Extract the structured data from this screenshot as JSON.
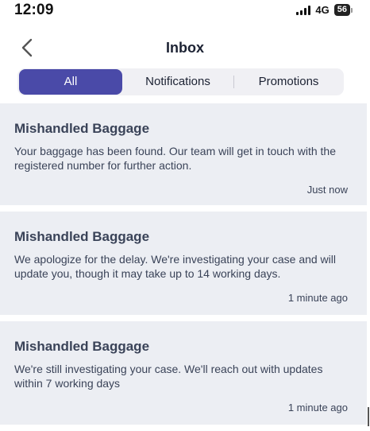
{
  "status": {
    "time": "12:09",
    "network": "4G",
    "battery": "56"
  },
  "header": {
    "title": "Inbox",
    "back_icon": "chevron-left-icon"
  },
  "tabs": [
    {
      "label": "All",
      "active": true
    },
    {
      "label": "Notifications",
      "active": false
    },
    {
      "label": "Promotions",
      "active": false
    }
  ],
  "messages": [
    {
      "title": "Mishandled Baggage",
      "body": "Your baggage has been  found. Our team will get in touch with the registered number for further action.",
      "time": "Just now"
    },
    {
      "title": "Mishandled Baggage",
      "body": "We apologize for the delay. We're investigating your case and will update you, though it may take up to 14 working days.",
      "time": "1 minute ago"
    },
    {
      "title": "Mishandled Baggage",
      "body": "We're still investigating your case. We'll reach out with updates within 7 working days",
      "time": "1 minute ago"
    }
  ],
  "colors": {
    "accent": "#4a4aa8",
    "card_bg": "#eceef3",
    "text": "#3a4358"
  }
}
